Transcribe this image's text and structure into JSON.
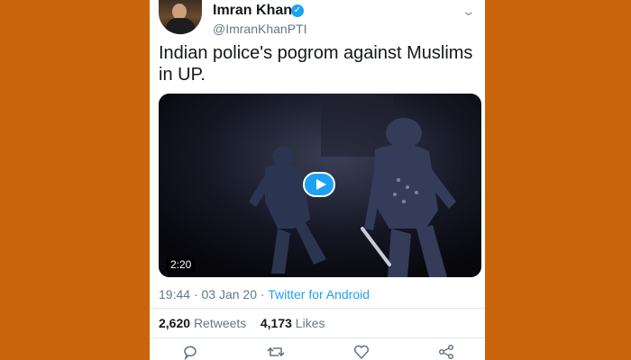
{
  "tweet": {
    "author_name": "Imran Khan",
    "handle": "@ImranKhanPTI",
    "text": "Indian police's pogrom against Muslims in UP.",
    "video_duration": "2:20",
    "time": "19:44",
    "date": "03 Jan 20",
    "source": "Twitter for Android",
    "retweets_count": "2,620",
    "retweets_label": "Retweets",
    "likes_count": "4,173",
    "likes_label": "Likes"
  },
  "colors": {
    "background": "#c8650c",
    "accent": "#1da1f2",
    "text": "#14171a",
    "muted": "#657786"
  },
  "icons": {
    "verified": "verified-badge-icon",
    "chevron": "chevron-down-icon",
    "reply": "reply-icon",
    "retweet": "retweet-icon",
    "like": "heart-icon",
    "share": "share-icon"
  }
}
